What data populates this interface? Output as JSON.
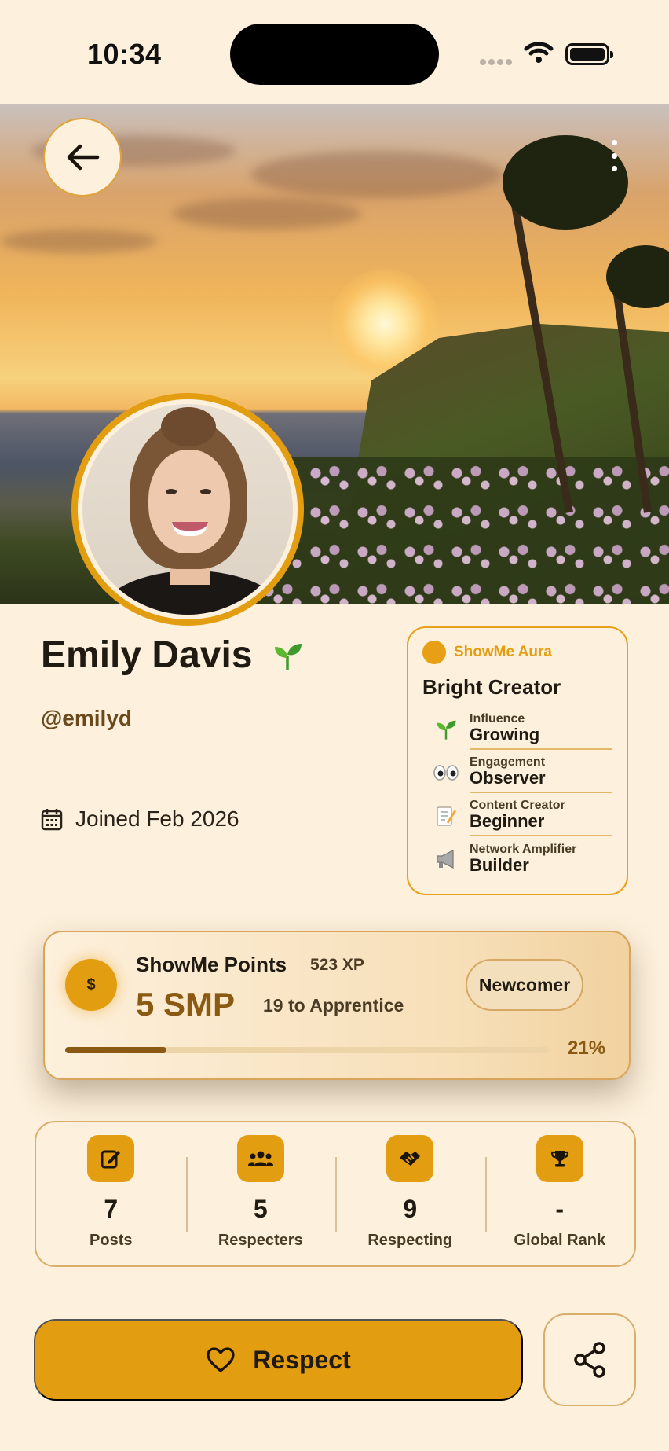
{
  "status_bar": {
    "time": "10:34"
  },
  "profile": {
    "name": "Emily Davis",
    "name_badge_icon": "sprout-icon",
    "handle": "@emilyd",
    "joined": "Joined Feb 2026"
  },
  "aura": {
    "label": "ShowMe Aura",
    "title": "Bright Creator",
    "items": [
      {
        "icon": "sprout-icon",
        "key": "Influence",
        "value": "Growing"
      },
      {
        "icon": "eyes-icon",
        "key": "Engagement",
        "value": "Observer"
      },
      {
        "icon": "memo-icon",
        "key": "Content Creator",
        "value": "Beginner"
      },
      {
        "icon": "megaphone-icon",
        "key": "Network Amplifier",
        "value": "Builder"
      }
    ]
  },
  "points": {
    "title": "ShowMe Points",
    "xp": "523 XP",
    "value": "5 SMP",
    "next": "19 to Apprentice",
    "rank": "Newcomer",
    "progress_percent": 21,
    "progress_label": "21%"
  },
  "stats": [
    {
      "icon": "edit-icon",
      "value": "7",
      "label": "Posts"
    },
    {
      "icon": "group-icon",
      "value": "5",
      "label": "Respecters"
    },
    {
      "icon": "handshake-icon",
      "value": "9",
      "label": "Respecting"
    },
    {
      "icon": "trophy-icon",
      "value": "-",
      "label": "Global Rank"
    }
  ],
  "actions": {
    "respect_label": "Respect",
    "share_icon": "share-icon"
  },
  "colors": {
    "accent": "#E39D10",
    "background": "#FDF0DC",
    "text": "#1F1A12"
  }
}
